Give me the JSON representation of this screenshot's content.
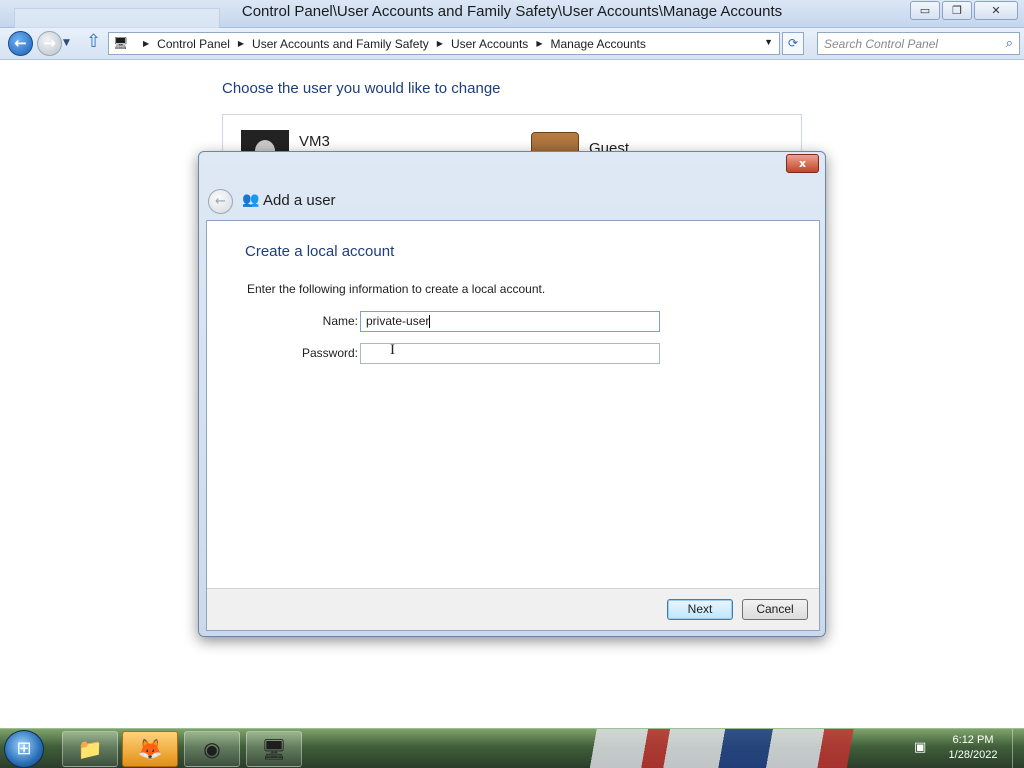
{
  "window": {
    "title": "Control Panel\\User Accounts and Family Safety\\User Accounts\\Manage Accounts",
    "min_glyph": "▭",
    "max_glyph": "❐",
    "close_glyph": "✕"
  },
  "nav": {
    "back_glyph": "←",
    "forward_glyph": "→",
    "up_glyph": "⇧",
    "breadcrumb": [
      "Control Panel",
      "User Accounts and Family Safety",
      "User Accounts",
      "Manage Accounts"
    ],
    "search_placeholder": "Search Control Panel"
  },
  "main": {
    "heading": "Choose the user you would like to change",
    "users": [
      {
        "name": "VM3"
      },
      {
        "name": "Guest"
      }
    ]
  },
  "dialog": {
    "title": "Add a user",
    "heading": "Create a local account",
    "description": "Enter the following information to create a local account.",
    "name_label": "Name:",
    "name_value": "private-user",
    "password_label": "Password:",
    "password_value": "",
    "next_label": "Next",
    "cancel_label": "Cancel",
    "close_glyph": "x"
  },
  "taskbar": {
    "items": [
      "windows-explorer",
      "firefox",
      "chrome",
      "control-panel"
    ],
    "time": "6:12 PM",
    "date": "1/28/2022"
  }
}
